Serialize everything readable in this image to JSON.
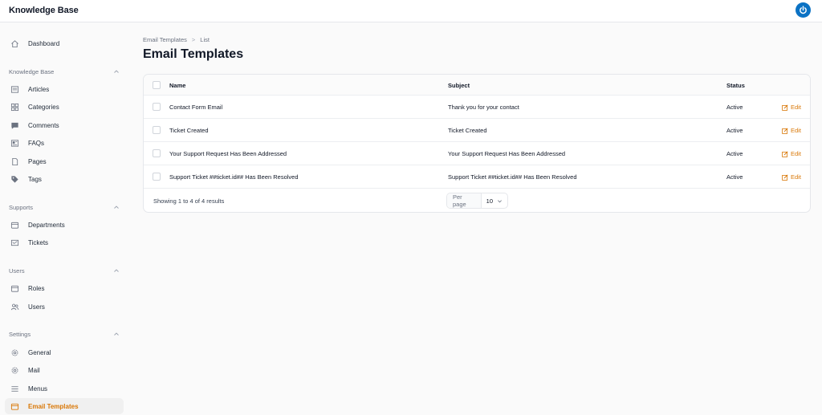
{
  "app": {
    "title": "Knowledge Base",
    "accent": "#d97706",
    "brand_blue": "#0b72c4"
  },
  "sidebar": {
    "dashboard": {
      "label": "Dashboard",
      "icon": "home-icon"
    },
    "groups": [
      {
        "label": "Knowledge Base",
        "items": [
          {
            "label": "Articles",
            "icon": "newspaper-icon"
          },
          {
            "label": "Categories",
            "icon": "grid-icon"
          },
          {
            "label": "Comments",
            "icon": "chat-icon"
          },
          {
            "label": "FAQs",
            "icon": "faq-icon"
          },
          {
            "label": "Pages",
            "icon": "document-icon"
          },
          {
            "label": "Tags",
            "icon": "tag-icon"
          }
        ]
      },
      {
        "label": "Supports",
        "items": [
          {
            "label": "Departments",
            "icon": "inbox-icon"
          },
          {
            "label": "Tickets",
            "icon": "ticket-icon"
          }
        ]
      },
      {
        "label": "Users",
        "items": [
          {
            "label": "Roles",
            "icon": "inbox-icon"
          },
          {
            "label": "Users",
            "icon": "users-icon"
          }
        ]
      },
      {
        "label": "Settings",
        "items": [
          {
            "label": "General",
            "icon": "gear-icon"
          },
          {
            "label": "Mail",
            "icon": "gear-icon"
          },
          {
            "label": "Menus",
            "icon": "menu-icon"
          },
          {
            "label": "Email Templates",
            "icon": "inbox-icon",
            "active": true
          }
        ]
      }
    ]
  },
  "breadcrumb": [
    "Email Templates",
    "List"
  ],
  "page_title": "Email Templates",
  "table": {
    "columns": [
      "Name",
      "Subject",
      "Status"
    ],
    "rows": [
      {
        "name": "Contact Form Email",
        "subject": "Thank you for your contact",
        "status": "Active",
        "action": "Edit"
      },
      {
        "name": "Ticket Created",
        "subject": "Ticket Created",
        "status": "Active",
        "action": "Edit"
      },
      {
        "name": "Your Support Request Has Been Addressed",
        "subject": "Your Support Request Has Been Addressed",
        "status": "Active",
        "action": "Edit"
      },
      {
        "name": "Support Ticket ##ticket.id## Has Been Resolved",
        "subject": "Support Ticket ##ticket.id## Has Been Resolved",
        "status": "Active",
        "action": "Edit"
      }
    ],
    "footer": {
      "showing": "Showing 1 to 4 of 4 results",
      "per_page_label": "Per page",
      "per_page_value": "10"
    }
  }
}
